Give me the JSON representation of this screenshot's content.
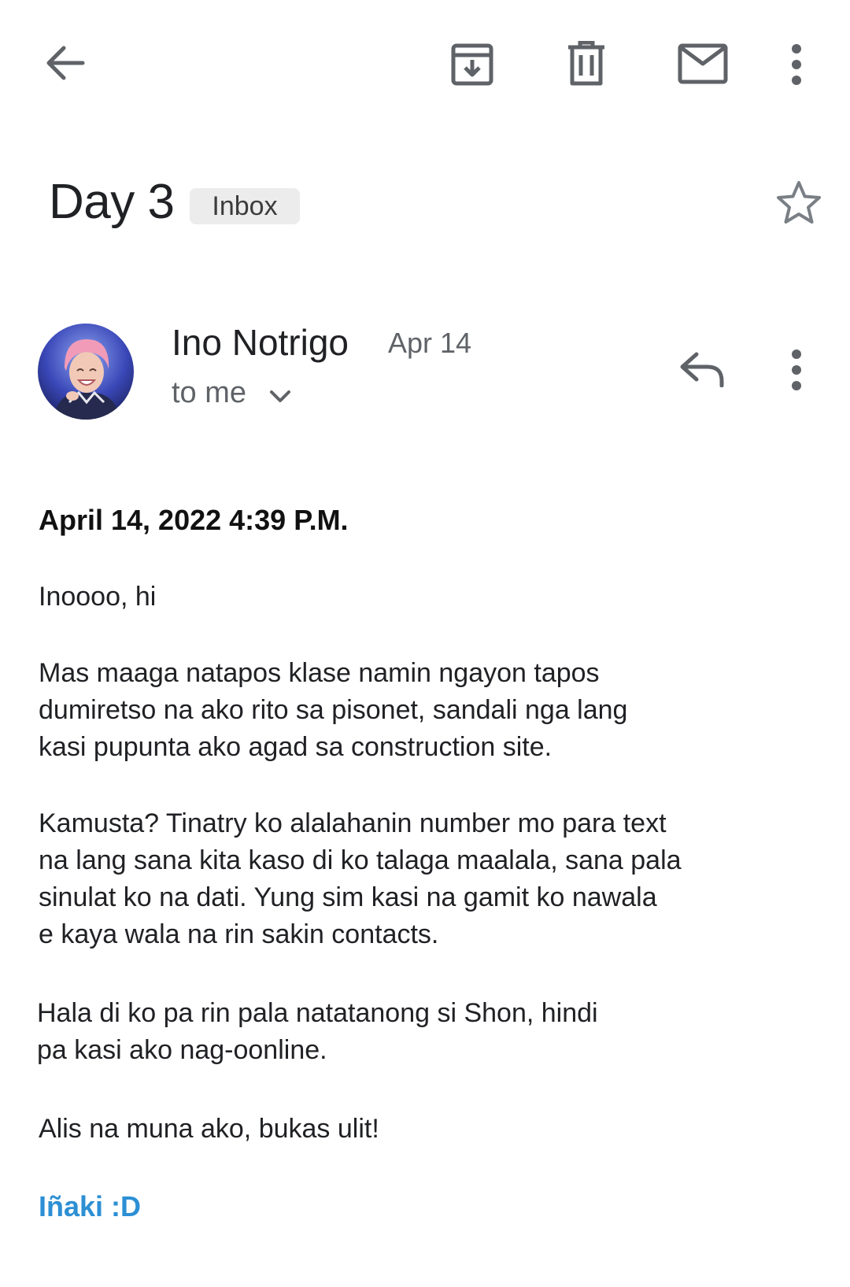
{
  "toolbar": {
    "back_icon": "arrow-left-icon",
    "archive_icon": "archive-icon",
    "delete_icon": "trash-icon",
    "mark_unread_icon": "envelope-icon",
    "more_icon": "more-vertical-icon"
  },
  "email": {
    "subject": "Day 3",
    "label": "Inbox",
    "star_icon": "star-outline-icon",
    "sender": {
      "name": "Ino Notrigo",
      "date": "Apr 14",
      "recipient": "to me",
      "avatar_icon": "avatar-photo"
    },
    "actions": {
      "reply_icon": "reply-icon",
      "more_icon": "more-vertical-icon"
    },
    "body": {
      "timestamp": "April 14, 2022 4:39 P.M.",
      "greeting": "Inoooo, hi",
      "paragraph1": [
        "Mas maaga natapos klase namin ngayon tapos",
        "dumiretso na ako rito sa pisonet, sandali nga lang",
        "kasi pupunta ako agad sa construction site."
      ],
      "paragraph2": [
        "Kamusta? Tinatry ko alalahanin number mo para text",
        "na lang sana kita kaso di ko talaga maalala, sana pala",
        "sinulat ko na dati. Yung sim kasi na gamit ko nawala",
        "e kaya wala na rin sakin contacts."
      ],
      "paragraph3": [
        "Hala di ko pa rin pala natatanong si Shon, hindi",
        "pa kasi ako nag-oonline."
      ],
      "closing": "Alis na muna ako, bukas ulit!",
      "signature": "Iñaki :D"
    }
  },
  "colors": {
    "icon": "#5f6368",
    "signature": "#2c8fd4",
    "chip_bg": "#ececec"
  }
}
